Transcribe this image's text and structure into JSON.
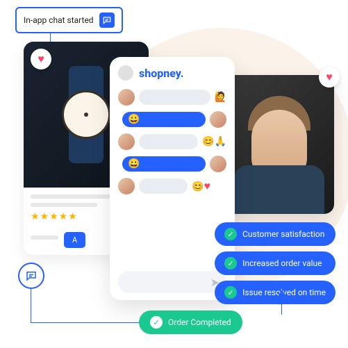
{
  "tag": {
    "label": "In-app chat started"
  },
  "product": {
    "stars": "★★★★★",
    "add_label": "A"
  },
  "chat": {
    "brand": "shopney"
  },
  "person_heart": "♥",
  "benefits": [
    {
      "label": "Customer satisfaction"
    },
    {
      "label": "Increased order value"
    },
    {
      "label": "Issue resolved on time"
    }
  ],
  "order": {
    "label": "Order Completed"
  }
}
